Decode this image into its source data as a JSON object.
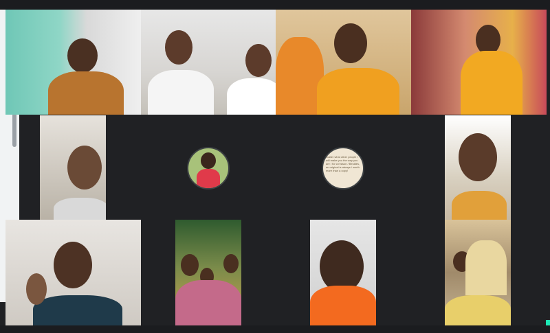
{
  "meeting": {
    "participants": [
      {
        "id": "p1",
        "initial": ""
      },
      {
        "id": "p2",
        "initial": ""
      },
      {
        "id": "p3",
        "initial": ""
      },
      {
        "id": "p4",
        "initial": ""
      },
      {
        "id": "p5",
        "initial": ""
      },
      {
        "id": "p6",
        "initial": ""
      },
      {
        "id": "p7",
        "initial": ""
      },
      {
        "id": "p8",
        "initial": ""
      },
      {
        "id": "p9",
        "initial": ""
      },
      {
        "id": "p10",
        "initial": ""
      },
      {
        "id": "p11",
        "initial": ""
      },
      {
        "id": "p12",
        "initial": ""
      }
    ],
    "avatar_quote_text": "matter what other people / will make you the way you are / for a reason / Besides, an original is always / worth more than a copy!"
  },
  "colors": {
    "background": "#202124",
    "accent": "#1de9b6"
  }
}
